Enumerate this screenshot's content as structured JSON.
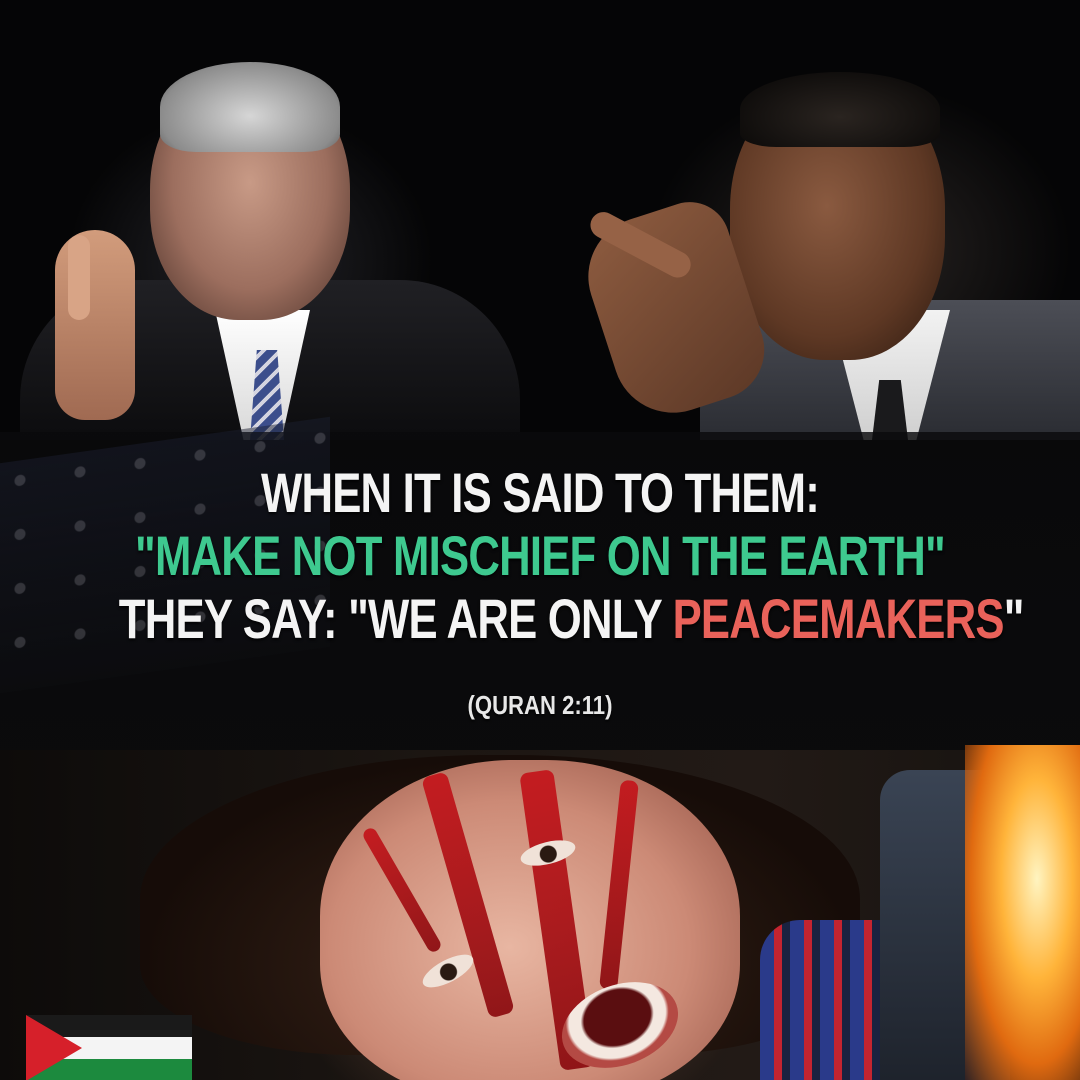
{
  "caption": {
    "line1": "WHEN IT IS SAID TO THEM:",
    "line2": "\"MAKE NOT MISCHIEF ON THE EARTH\"",
    "line3_prefix": "THEY SAY: \"WE ARE ONLY ",
    "line3_highlight": "PEACEMAKERS",
    "line3_suffix": "\"",
    "citation": "(QURAN 2:11)"
  },
  "colors": {
    "white_text": "#f4f4f4",
    "green_text": "#3ec98f",
    "red_text": "#e9625a"
  }
}
